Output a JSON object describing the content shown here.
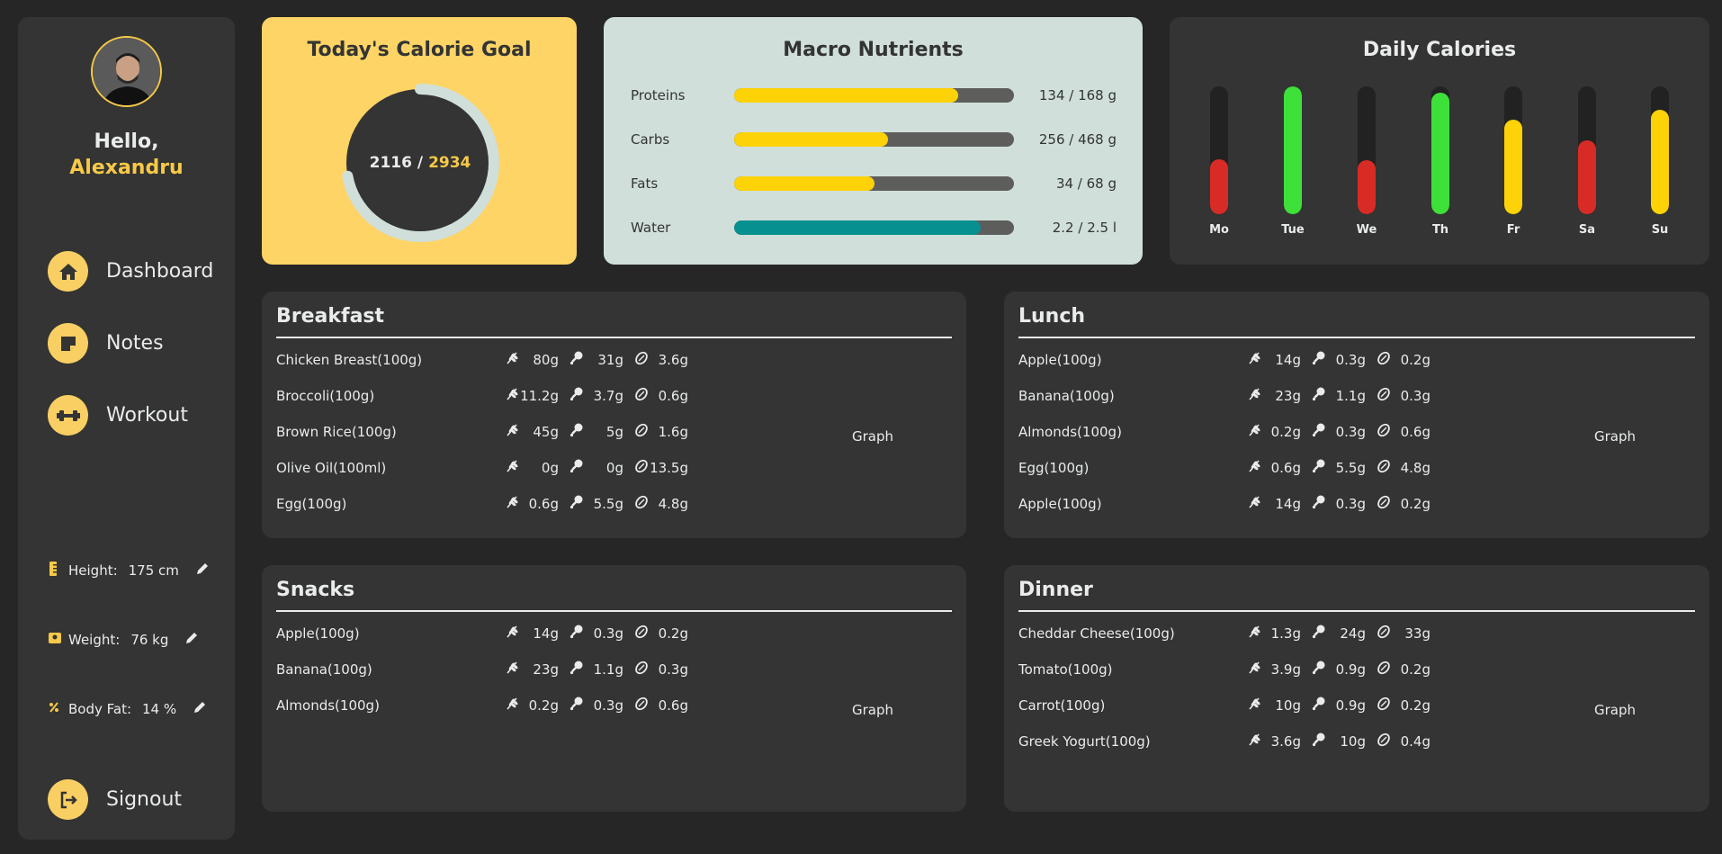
{
  "user": {
    "greeting": "Hello,",
    "name": "Alexandru"
  },
  "nav": [
    {
      "label": "Dashboard",
      "icon": "home-icon"
    },
    {
      "label": "Notes",
      "icon": "note-icon"
    },
    {
      "label": "Workout",
      "icon": "dumbbell-icon"
    }
  ],
  "stats": [
    {
      "label": "Height:",
      "value": "175 cm",
      "icon": "ruler-icon"
    },
    {
      "label": "Weight:",
      "value": "76 kg",
      "icon": "scale-icon"
    },
    {
      "label": "Body Fat:",
      "value": "14 %",
      "icon": "percent-icon"
    }
  ],
  "signout": {
    "label": "Signout",
    "icon": "signout-icon"
  },
  "goal": {
    "title": "Today's Calorie Goal",
    "current": "2116 /",
    "target": "2934",
    "progress": 0.721
  },
  "macros": {
    "title": "Macro Nutrients",
    "rows": [
      {
        "name": "Proteins",
        "value": "134 / 168 g",
        "fraction": 0.8,
        "color": "#fdd207"
      },
      {
        "name": "Carbs",
        "value": "256 / 468 g",
        "fraction": 0.55,
        "color": "#fdd207"
      },
      {
        "name": "Fats",
        "value": "34 / 68 g",
        "fraction": 0.5,
        "color": "#fdd207"
      },
      {
        "name": "Water",
        "value": "2.2 / 2.5 l",
        "fraction": 0.88,
        "color": "#079090"
      }
    ]
  },
  "daily": {
    "title": "Daily Calories",
    "days": [
      {
        "label": "Mo",
        "fraction": 0.43,
        "color": "#d92b26"
      },
      {
        "label": "Tue",
        "fraction": 1.0,
        "color": "#3ee13a"
      },
      {
        "label": "We",
        "fraction": 0.42,
        "color": "#d92b26"
      },
      {
        "label": "Th",
        "fraction": 0.95,
        "color": "#3ee13a"
      },
      {
        "label": "Fr",
        "fraction": 0.74,
        "color": "#fdd207"
      },
      {
        "label": "Sa",
        "fraction": 0.58,
        "color": "#d92b26"
      },
      {
        "label": "Su",
        "fraction": 0.82,
        "color": "#fdd207"
      }
    ]
  },
  "meals": {
    "graph_label": "Graph",
    "breakfast": {
      "title": "Breakfast",
      "items": [
        {
          "name": "Chicken Breast(100g)",
          "carbs": "80g",
          "protein": "31g",
          "fat": "3.6g"
        },
        {
          "name": "Broccoli(100g)",
          "carbs": "11.2g",
          "protein": "3.7g",
          "fat": "0.6g"
        },
        {
          "name": "Brown Rice(100g)",
          "carbs": "45g",
          "protein": "5g",
          "fat": "1.6g"
        },
        {
          "name": "Olive Oil(100ml)",
          "carbs": "0g",
          "protein": "0g",
          "fat": "13.5g"
        },
        {
          "name": "Egg(100g)",
          "carbs": "0.6g",
          "protein": "5.5g",
          "fat": "4.8g"
        }
      ]
    },
    "lunch": {
      "title": "Lunch",
      "items": [
        {
          "name": "Apple(100g)",
          "carbs": "14g",
          "protein": "0.3g",
          "fat": "0.2g"
        },
        {
          "name": "Banana(100g)",
          "carbs": "23g",
          "protein": "1.1g",
          "fat": "0.3g"
        },
        {
          "name": "Almonds(100g)",
          "carbs": "0.2g",
          "protein": "0.3g",
          "fat": "0.6g"
        },
        {
          "name": "Egg(100g)",
          "carbs": "0.6g",
          "protein": "5.5g",
          "fat": "4.8g"
        },
        {
          "name": "Apple(100g)",
          "carbs": "14g",
          "protein": "0.3g",
          "fat": "0.2g"
        }
      ]
    },
    "snacks": {
      "title": "Snacks",
      "items": [
        {
          "name": "Apple(100g)",
          "carbs": "14g",
          "protein": "0.3g",
          "fat": "0.2g"
        },
        {
          "name": "Banana(100g)",
          "carbs": "23g",
          "protein": "1.1g",
          "fat": "0.3g"
        },
        {
          "name": "Almonds(100g)",
          "carbs": "0.2g",
          "protein": "0.3g",
          "fat": "0.6g"
        }
      ]
    },
    "dinner": {
      "title": "Dinner",
      "items": [
        {
          "name": "Cheddar Cheese(100g)",
          "carbs": "1.3g",
          "protein": "24g",
          "fat": "33g"
        },
        {
          "name": "Tomato(100g)",
          "carbs": "3.9g",
          "protein": "0.9g",
          "fat": "0.2g"
        },
        {
          "name": "Carrot(100g)",
          "carbs": "10g",
          "protein": "0.9g",
          "fat": "0.2g"
        },
        {
          "name": "Greek Yogurt(100g)",
          "carbs": "3.6g",
          "protein": "10g",
          "fat": "0.4g"
        }
      ]
    }
  }
}
